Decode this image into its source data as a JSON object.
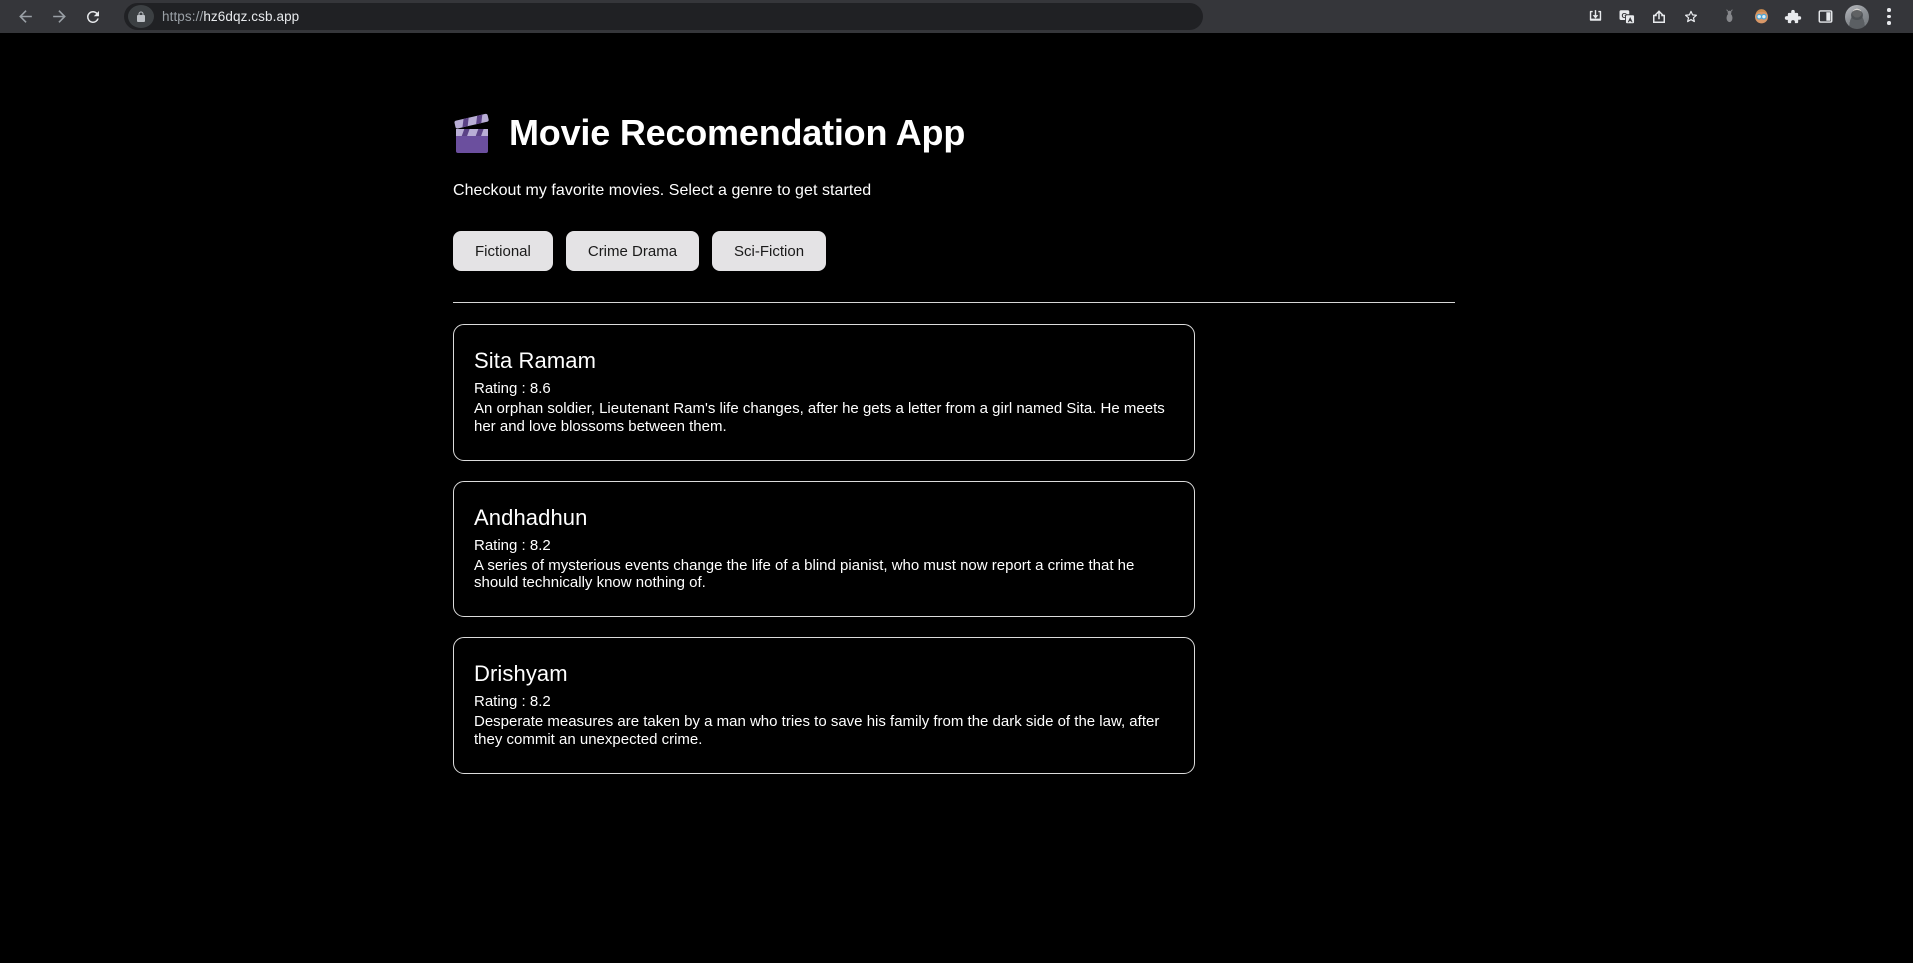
{
  "browser": {
    "back_icon": "back-arrow-icon",
    "forward_icon": "forward-arrow-icon",
    "reload_icon": "reload-icon",
    "lock_icon": "lock-icon",
    "url_scheme": "https://",
    "url_host": "hz6dqz.csb.app",
    "actions": [
      {
        "name": "download-icon",
        "glyph": ""
      },
      {
        "name": "translate-icon",
        "glyph": ""
      },
      {
        "name": "share-icon",
        "glyph": ""
      },
      {
        "name": "bookmark-star-icon",
        "glyph": ""
      },
      {
        "name": "bug-extension-icon",
        "glyph": "🐞"
      },
      {
        "name": "face-extension-icon",
        "glyph": "🥽"
      },
      {
        "name": "extensions-puzzle-icon",
        "glyph": ""
      },
      {
        "name": "side-panel-icon",
        "glyph": ""
      },
      {
        "name": "profile-avatar",
        "glyph": ""
      },
      {
        "name": "chrome-menu-icon",
        "glyph": ""
      }
    ]
  },
  "app": {
    "logo_icon": "clapperboard-icon",
    "title": "Movie Recomendation App",
    "subtitle": "Checkout my favorite movies. Select a genre to get started",
    "accent_purple": "#6b4f9e",
    "background": "#000000",
    "text_color": "#ffffff",
    "button_bg": "#e4e3e5"
  },
  "genres": [
    {
      "label": "Fictional"
    },
    {
      "label": "Crime Drama"
    },
    {
      "label": "Sci-Fiction"
    }
  ],
  "movies": [
    {
      "title": "Sita Ramam",
      "rating": "Rating : 8.6",
      "description": "An orphan soldier, Lieutenant Ram's life changes, after he gets a letter from a girl named Sita. He meets her and love blossoms between them."
    },
    {
      "title": "Andhadhun",
      "rating": "Rating : 8.2",
      "description": "A series of mysterious events change the life of a blind pianist, who must now report a crime that he should technically know nothing of."
    },
    {
      "title": "Drishyam",
      "rating": "Rating : 8.2",
      "description": "Desperate measures are taken by a man who tries to save his family from the dark side of the law, after they commit an unexpected crime."
    }
  ]
}
